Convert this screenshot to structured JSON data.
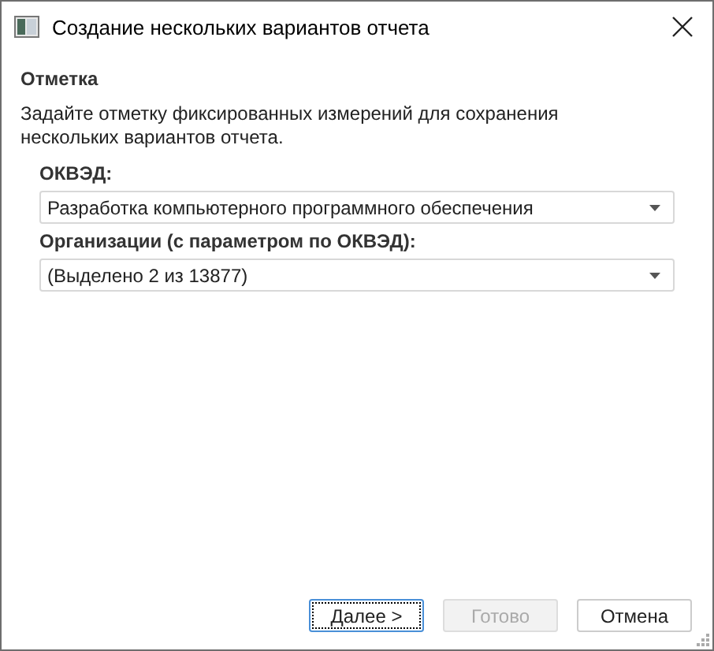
{
  "window": {
    "title": "Создание нескольких вариантов отчета"
  },
  "section": {
    "heading": "Отметка",
    "description": "Задайте отметку фиксированных измерений для сохранения нескольких вариантов отчета."
  },
  "fields": [
    {
      "label": "ОКВЭД:",
      "value": "Разработка компьютерного программного обеспечения"
    },
    {
      "label": "Организации (с параметром по ОКВЭД):",
      "value": "(Выделено 2 из 13877)"
    }
  ],
  "buttons": [
    {
      "label": "Далее >",
      "disabled": false,
      "focused": true
    },
    {
      "label": "Готово",
      "disabled": true,
      "focused": false
    },
    {
      "label": "Отмена",
      "disabled": false,
      "focused": false
    }
  ]
}
